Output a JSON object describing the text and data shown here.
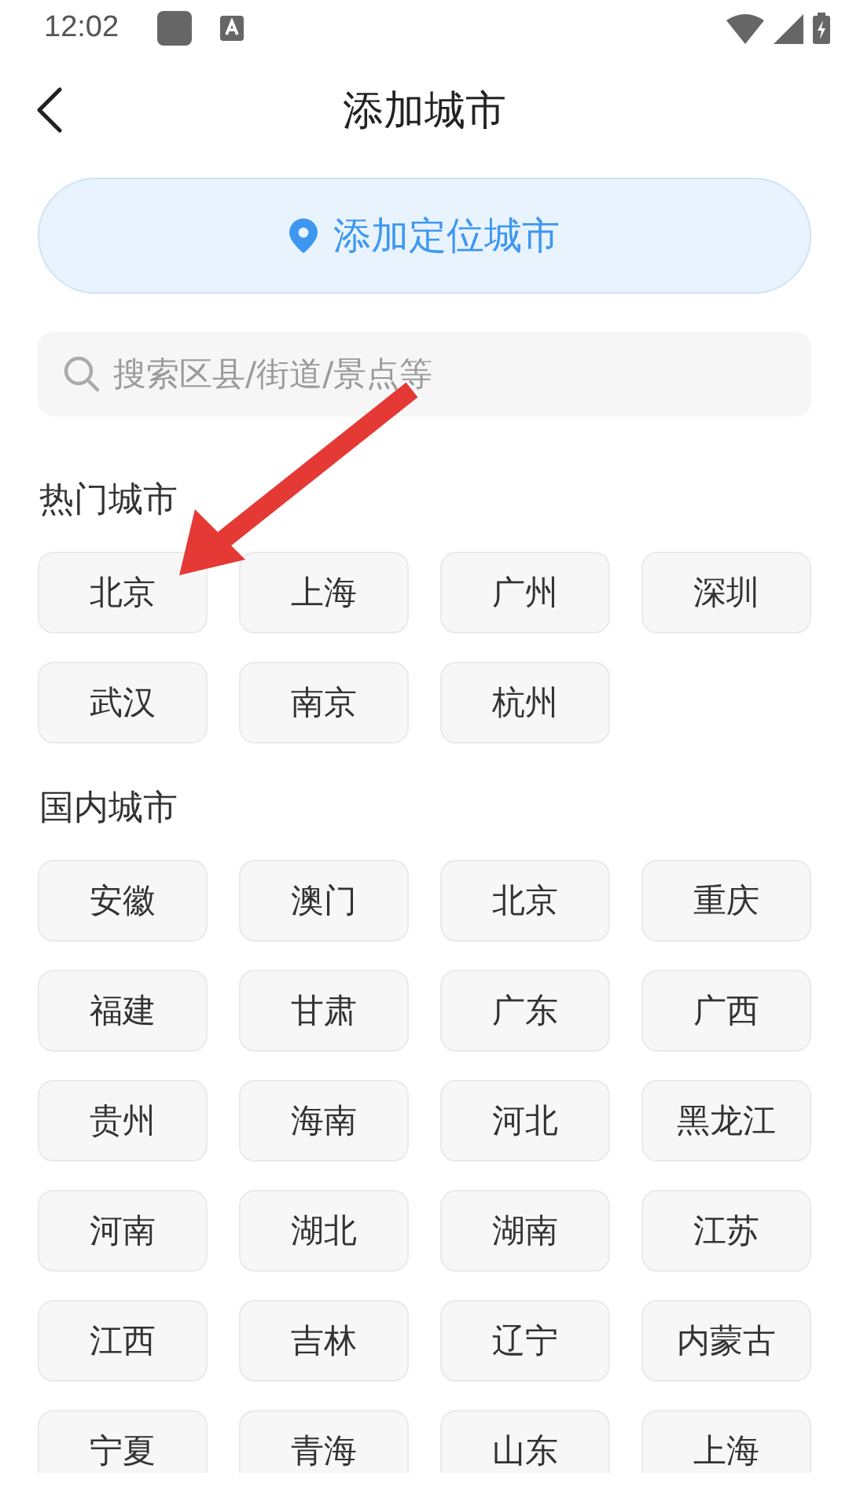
{
  "status_bar": {
    "time": "12:02"
  },
  "header": {
    "title": "添加城市"
  },
  "locate_button": {
    "label": "添加定位城市"
  },
  "search": {
    "placeholder": "搜索区县/街道/景点等"
  },
  "sections": [
    {
      "title": "热门城市",
      "cities": [
        "北京",
        "上海",
        "广州",
        "深圳",
        "武汉",
        "南京",
        "杭州"
      ]
    },
    {
      "title": "国内城市",
      "cities": [
        "安徽",
        "澳门",
        "北京",
        "重庆",
        "福建",
        "甘肃",
        "广东",
        "广西",
        "贵州",
        "海南",
        "河北",
        "黑龙江",
        "河南",
        "湖北",
        "湖南",
        "江苏",
        "江西",
        "吉林",
        "辽宁",
        "内蒙古",
        "宁夏",
        "青海",
        "山东",
        "上海"
      ]
    }
  ]
}
